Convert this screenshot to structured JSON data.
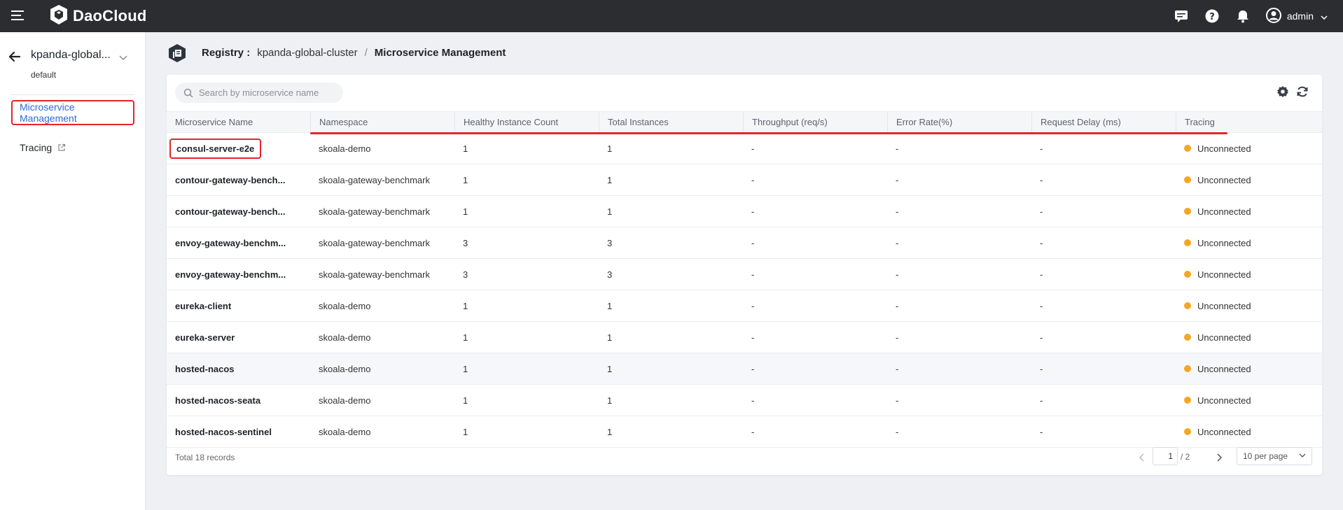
{
  "app": {
    "brand": "DaoCloud",
    "user": "admin"
  },
  "sidebar": {
    "cluster_name": "kpanda-global...",
    "namespace": "default",
    "items": [
      {
        "label": "Microservice Management",
        "active": true
      },
      {
        "label": "Tracing",
        "active": false
      }
    ]
  },
  "breadcrumb": {
    "label": "Registry :",
    "cluster": "kpanda-global-cluster",
    "separator": "/",
    "current": "Microservice Management"
  },
  "search": {
    "placeholder": "Search by microservice name"
  },
  "table": {
    "columns": [
      "Microservice Name",
      "Namespace",
      "Healthy Instance Count",
      "Total Instances",
      "Throughput (req/s)",
      "Error Rate(%)",
      "Request Delay (ms)",
      "Tracing"
    ],
    "rows": [
      {
        "name": "consul-server-e2e",
        "namespace": "skoala-demo",
        "healthy": "1",
        "total": "1",
        "throughput": "-",
        "error_rate": "-",
        "delay": "-",
        "tracing": "Unconnected"
      },
      {
        "name": "contour-gateway-bench...",
        "namespace": "skoala-gateway-benchmark",
        "healthy": "1",
        "total": "1",
        "throughput": "-",
        "error_rate": "-",
        "delay": "-",
        "tracing": "Unconnected"
      },
      {
        "name": "contour-gateway-bench...",
        "namespace": "skoala-gateway-benchmark",
        "healthy": "1",
        "total": "1",
        "throughput": "-",
        "error_rate": "-",
        "delay": "-",
        "tracing": "Unconnected"
      },
      {
        "name": "envoy-gateway-benchm...",
        "namespace": "skoala-gateway-benchmark",
        "healthy": "3",
        "total": "3",
        "throughput": "-",
        "error_rate": "-",
        "delay": "-",
        "tracing": "Unconnected"
      },
      {
        "name": "envoy-gateway-benchm...",
        "namespace": "skoala-gateway-benchmark",
        "healthy": "3",
        "total": "3",
        "throughput": "-",
        "error_rate": "-",
        "delay": "-",
        "tracing": "Unconnected"
      },
      {
        "name": "eureka-client",
        "namespace": "skoala-demo",
        "healthy": "1",
        "total": "1",
        "throughput": "-",
        "error_rate": "-",
        "delay": "-",
        "tracing": "Unconnected"
      },
      {
        "name": "eureka-server",
        "namespace": "skoala-demo",
        "healthy": "1",
        "total": "1",
        "throughput": "-",
        "error_rate": "-",
        "delay": "-",
        "tracing": "Unconnected"
      },
      {
        "name": "hosted-nacos",
        "namespace": "skoala-demo",
        "healthy": "1",
        "total": "1",
        "throughput": "-",
        "error_rate": "-",
        "delay": "-",
        "tracing": "Unconnected"
      },
      {
        "name": "hosted-nacos-seata",
        "namespace": "skoala-demo",
        "healthy": "1",
        "total": "1",
        "throughput": "-",
        "error_rate": "-",
        "delay": "-",
        "tracing": "Unconnected"
      },
      {
        "name": "hosted-nacos-sentinel",
        "namespace": "skoala-demo",
        "healthy": "1",
        "total": "1",
        "throughput": "-",
        "error_rate": "-",
        "delay": "-",
        "tracing": "Unconnected"
      }
    ]
  },
  "pagination": {
    "total_text": "Total 18 records",
    "current_page": "1",
    "total_pages": "/ 2",
    "page_size": "10 per page"
  },
  "colors": {
    "topbar": "#2c2d30",
    "accent": "#2f6bd9",
    "highlight": "#e5242b",
    "status_unconnected": "#f5a623"
  },
  "icons": [
    "menu-icon",
    "daocloud-logo-icon",
    "message-icon",
    "help-icon",
    "bell-icon",
    "user-avatar-icon",
    "back-arrow-icon",
    "chevron-down-icon",
    "external-link-icon",
    "registry-icon",
    "search-icon",
    "settings-icon",
    "refresh-icon",
    "chevron-left-icon",
    "chevron-right-icon"
  ]
}
